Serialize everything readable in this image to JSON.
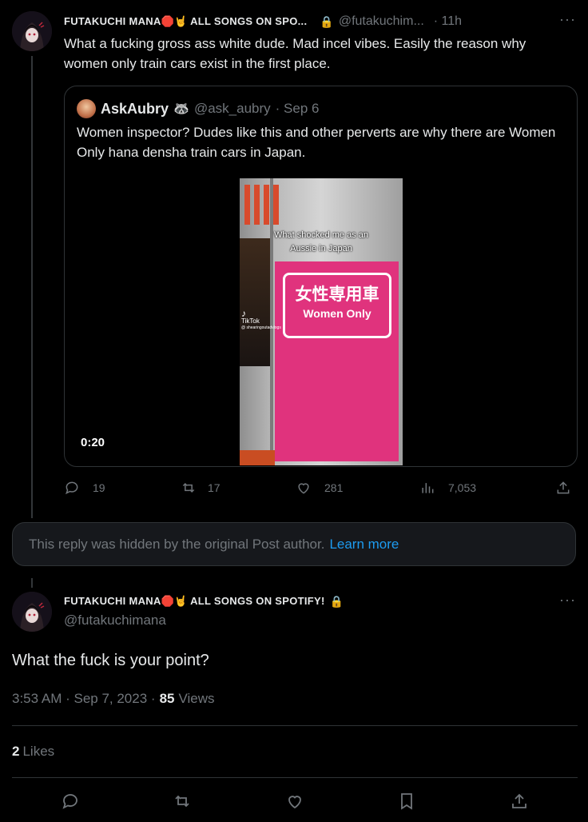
{
  "tweet": {
    "author_name": "FUTAKUCHI MANA🛑🤘 ALL SONGS ON SPO...",
    "lock_icon": "🔒",
    "handle": "@futakuchim...",
    "time": "· 11h",
    "more": "···",
    "text": "What a fucking gross ass white dude. Mad incel vibes. Easily the reason why women only train cars exist in the first place.",
    "quote": {
      "author_name": "AskAubry",
      "badge": "🦝",
      "handle": "@ask_aubry",
      "date": "· Sep 6",
      "text": "Women inspector? Dudes like this and other perverts are why there are Women Only hana densha train cars in Japan.",
      "video": {
        "duration": "0:20",
        "caption_line1": "What shocked me as an",
        "caption_line2": "Aussie in Japan",
        "sign_jp": "女性専用車",
        "sign_en": "Women Only",
        "tiktok_label": "TikTok",
        "tiktok_handle": "@ shearingoutadvlogs"
      }
    },
    "actions": {
      "replies": "19",
      "retweets": "17",
      "likes": "281",
      "views": "7,053"
    }
  },
  "hidden_notice": {
    "text": "This reply was hidden by the original Post author.",
    "link": "Learn more"
  },
  "main_tweet": {
    "author_name": "FUTAKUCHI MANA🛑🤘 ALL SONGS ON SPOTIFY!",
    "lock_icon": "🔒",
    "handle": "@futakuchimana",
    "more": "···",
    "text": "What the fuck is your point?",
    "timestamp": "3:53 AM · Sep 7, 2023 ·",
    "views_count": "85",
    "views_label": "Views",
    "likes_count": "2",
    "likes_label": "Likes"
  },
  "colors": {
    "background": "#000000",
    "text": "#e7e9ea",
    "muted": "#71767b",
    "link": "#1d9bf0",
    "border": "#2f3336",
    "sign_pink": "#e0337d"
  }
}
